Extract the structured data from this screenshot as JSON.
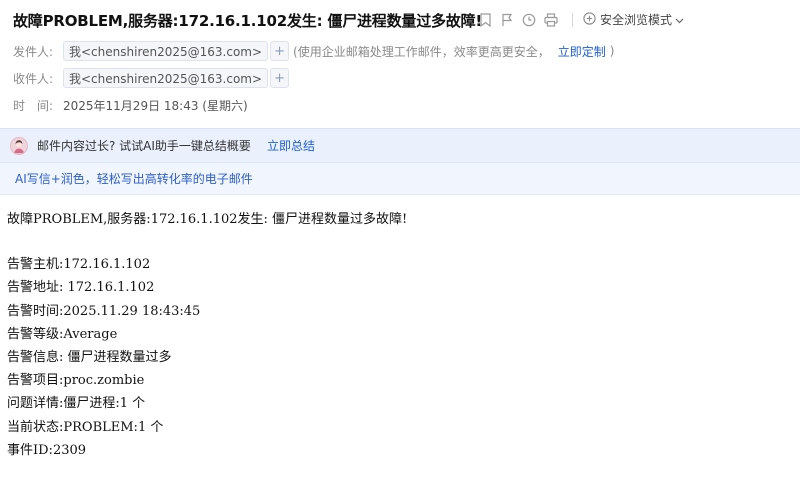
{
  "email": {
    "subject": "故障PROBLEM,服务器:172.16.1.102发生: 僵尸进程数量过多故障!",
    "toolbar": {
      "icons": [
        "bookmark-icon",
        "flag-icon",
        "clock-icon",
        "print-icon"
      ],
      "safe_mode_label": "安全浏览模式"
    },
    "from": {
      "label": "发件人:",
      "sender": "我<chenshiren2025@163.com>",
      "hint_prefix": "(使用企业邮箱处理工作邮件，效率更高更安全，",
      "hint_link": "立即定制",
      "hint_suffix": ")"
    },
    "to": {
      "label": "收件人:",
      "recipient": "我<chenshiren2025@163.com>"
    },
    "time": {
      "label": "时　间:",
      "value": "2025年11月29日 18:43 (星期六)"
    }
  },
  "banners": {
    "summary_text": "邮件内容过长? 试试AI助手一键总结概要",
    "summary_link": "立即总结",
    "ai_write_text": "AI写信+润色，轻松写出高转化率的电子邮件"
  },
  "body_lines": {
    "title": "故障PROBLEM,服务器:172.16.1.102发生: 僵尸进程数量过多故障!",
    "host": "告警主机:172.16.1.102",
    "address": "告警地址: 172.16.1.102",
    "time": "告警时间:2025.11.29 18:43:45",
    "level": "告警等级:Average",
    "info": "告警信息: 僵尸进程数量过多",
    "item": "告警项目:proc.zombie",
    "detail": "问题详情:僵尸进程:1 个",
    "status": "当前状态:PROBLEM:1 个",
    "event_id": "事件ID:2309"
  },
  "colors": {
    "link": "#2060d0",
    "banner1_bg": "#eaf1fd",
    "banner2_bg": "#f1f5fd",
    "ai_text": "#2d5fc4"
  }
}
